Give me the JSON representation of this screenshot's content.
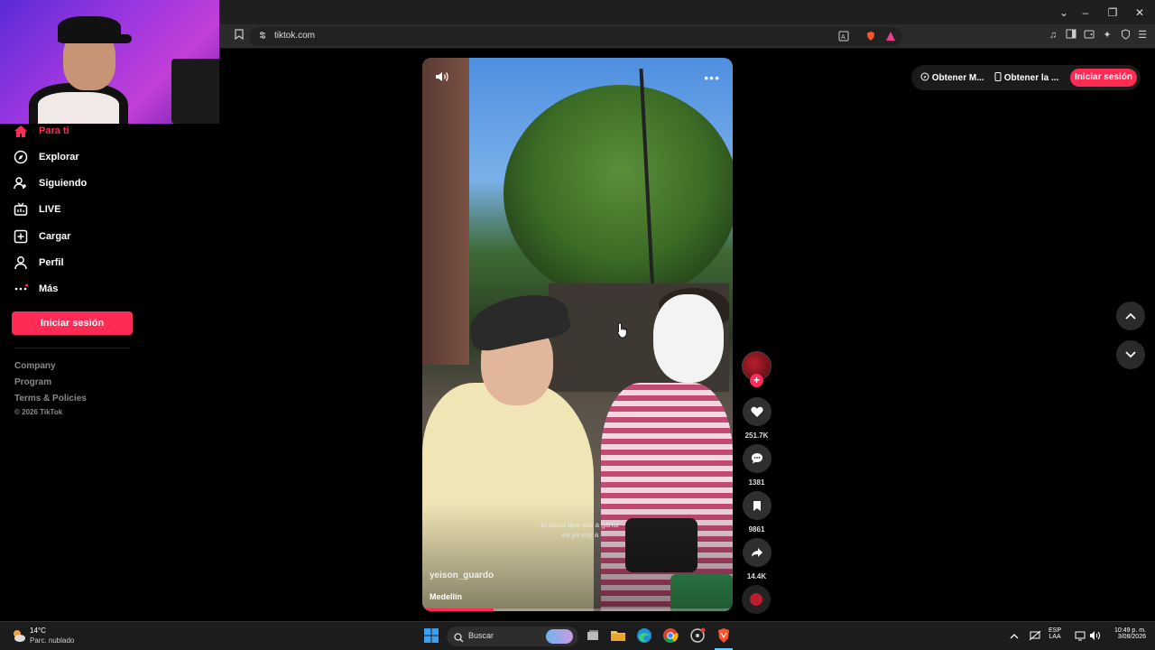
{
  "browser": {
    "url": "tiktok.com",
    "window_controls": {
      "chevron": "⌄",
      "minimize": "–",
      "restore": "❐",
      "close": "✕"
    }
  },
  "sidebar": {
    "items": [
      {
        "label": "Para ti",
        "icon": "home-icon",
        "active": true
      },
      {
        "label": "Explorar",
        "icon": "compass-icon"
      },
      {
        "label": "Siguiendo",
        "icon": "user-follow-icon"
      },
      {
        "label": "LIVE",
        "icon": "live-icon"
      },
      {
        "label": "Cargar",
        "icon": "upload-icon"
      },
      {
        "label": "Perfil",
        "icon": "profile-icon"
      },
      {
        "label": "Más",
        "icon": "more-dots-icon"
      }
    ],
    "login_button": "Iniciar sesión",
    "footer": [
      "Company",
      "Program",
      "Terms & Policies",
      "© 2026 TikTok"
    ]
  },
  "video": {
    "subtitle": "lo único que vas a ganar es yo voy a",
    "username": "yeison_guardo",
    "location": "Medellín",
    "progress": 0.23
  },
  "actions": {
    "likes": "251.7K",
    "comments": "1381",
    "saves": "9861",
    "shares": "14.4K"
  },
  "topright": {
    "get_app_1": "Obtener M...",
    "get_app_2": "Obtener la ...",
    "login": "Iniciar sesión"
  },
  "taskbar": {
    "temperature": "14°C",
    "weather": "Parc. nublado",
    "search_placeholder": "Buscar",
    "lang_1": "ESP",
    "lang_2": "LAA",
    "time": "10:49 p. m.",
    "date": "3/08/2026"
  },
  "colors": {
    "brand": "#fe2c55",
    "background": "#000000"
  }
}
